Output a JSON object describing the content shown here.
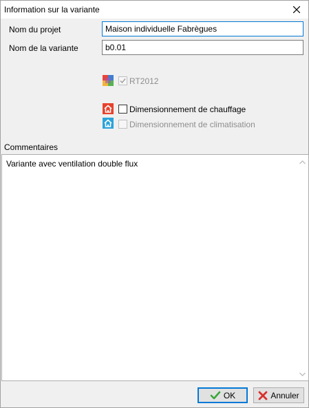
{
  "window": {
    "title": "Information sur la variante"
  },
  "fields": {
    "project_label": "Nom du projet",
    "project_value": "Maison individuelle Fabrègues",
    "variant_label": "Nom de la variante",
    "variant_value": "b0.01"
  },
  "options": {
    "rt2012": {
      "label": "RT2012",
      "checked": true,
      "enabled": false,
      "icon": "rt2012-multicolor-icon"
    },
    "heating": {
      "label": "Dimensionnement de chauffage",
      "checked": false,
      "enabled": true,
      "icon": "house-red-icon",
      "icon_color": "#e8412c"
    },
    "cooling": {
      "label": "Dimensionnement de climatisation",
      "checked": false,
      "enabled": false,
      "icon": "house-blue-icon",
      "icon_color": "#2ba3d9"
    }
  },
  "comments": {
    "label": "Commentaires",
    "text": "Variante avec ventilation double flux"
  },
  "buttons": {
    "ok": "OK",
    "cancel": "Annuler"
  },
  "colors": {
    "focus_border": "#0078d7",
    "ok_check": "#3aa63a",
    "cancel_x": "#d9302b"
  }
}
